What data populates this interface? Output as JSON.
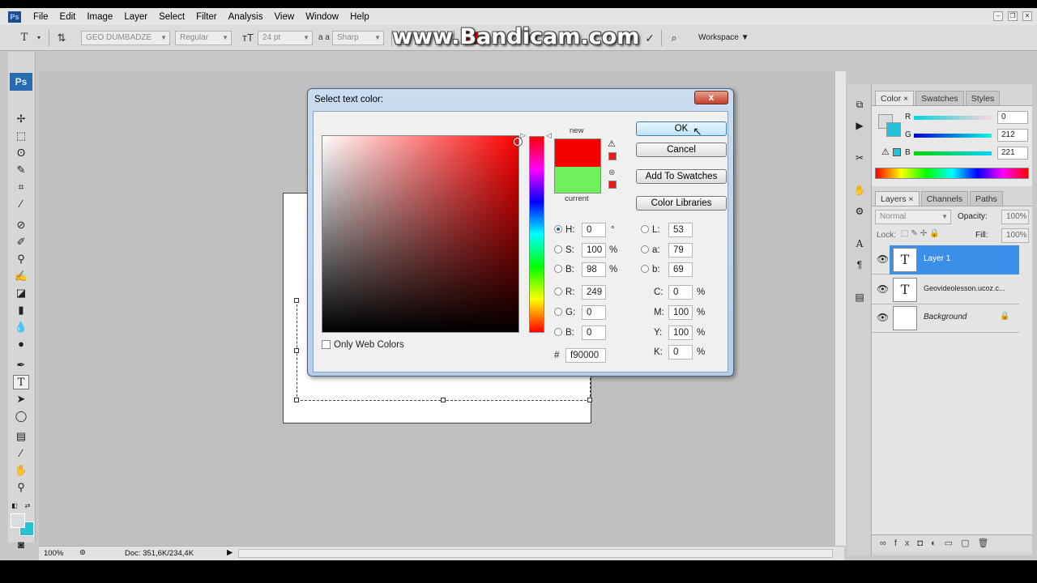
{
  "watermark": "www.Bandicam.com",
  "menu": [
    "File",
    "Edit",
    "Image",
    "Layer",
    "Select",
    "Filter",
    "Analysis",
    "View",
    "Window",
    "Help"
  ],
  "options_bar": {
    "tool_icon": "T",
    "font_family": "GEO DUMBADZE",
    "font_style": "Regular",
    "font_size": "24 pt",
    "aa_label": "a a",
    "antialias": "Sharp",
    "text_color": "#f90000",
    "workspace": "Workspace"
  },
  "dialog": {
    "title": "Select text color:",
    "close": "x",
    "new_label": "new",
    "current_label": "current",
    "new_color": "#f90000",
    "current_color": "#6ef05a",
    "buttons": {
      "ok": "OK",
      "cancel": "Cancel",
      "add_swatches": "Add To Swatches",
      "color_libraries": "Color Libraries"
    },
    "only_web_colors": "Only Web Colors",
    "hsb": {
      "h_label": "H:",
      "h": "0",
      "h_unit": "°",
      "s_label": "S:",
      "s": "100",
      "s_unit": "%",
      "b_label": "B:",
      "b": "98",
      "b_unit": "%"
    },
    "rgb": {
      "r_label": "R:",
      "r": "249",
      "g_label": "G:",
      "g": "0",
      "b_label": "B:",
      "b": "0"
    },
    "hex_label": "#",
    "hex": "f90000",
    "lab": {
      "l_label": "L:",
      "l": "53",
      "a_label": "a:",
      "a": "79",
      "b_label": "b:",
      "b": "69"
    },
    "cmyk": {
      "c_label": "C:",
      "c": "0",
      "m_label": "M:",
      "m": "100",
      "y_label": "Y:",
      "y": "100",
      "k_label": "K:",
      "k": "0",
      "unit": "%"
    }
  },
  "color_panel": {
    "tabs": [
      "Color",
      "Swatches",
      "Styles"
    ],
    "r_label": "R",
    "r": "0",
    "g_label": "G",
    "g": "212",
    "b_label": "B",
    "b": "221"
  },
  "layers_panel": {
    "tabs": [
      "Layers",
      "Channels",
      "Paths"
    ],
    "blend_mode": "Normal",
    "opacity_label": "Opacity:",
    "opacity": "100%",
    "lock_label": "Lock:",
    "fill_label": "Fill:",
    "fill": "100%",
    "layers": [
      {
        "name": "Layer 1",
        "thumb": "T",
        "selected": true
      },
      {
        "name": "Geovideolesson.ucoz.c...",
        "thumb": "T",
        "selected": false
      },
      {
        "name": "Background",
        "thumb": "",
        "selected": false
      }
    ]
  },
  "status": {
    "zoom": "100%",
    "doc": "Doc: 351,6K/234,4K"
  }
}
